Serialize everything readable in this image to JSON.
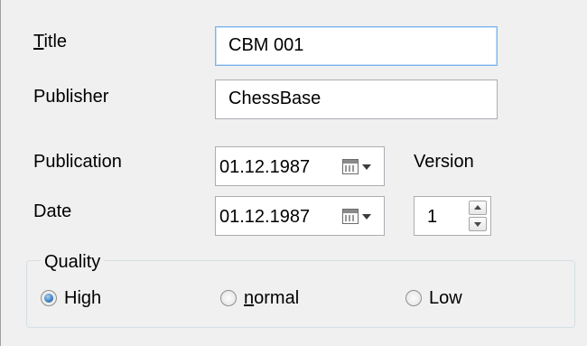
{
  "form": {
    "title": {
      "label_mnemonic": "T",
      "label_rest": "itle",
      "value": "CBM 001"
    },
    "publisher": {
      "label": "Publisher",
      "value": "ChessBase"
    },
    "publication": {
      "label": "Publication",
      "value": "01.12.1987"
    },
    "date": {
      "label": "Date",
      "value": "01.12.1987"
    },
    "version": {
      "label": "Version",
      "value": "1"
    }
  },
  "quality": {
    "title": "Quality",
    "options": [
      {
        "label": "High",
        "mnemonic": "",
        "checked": true
      },
      {
        "label_mnemonic": "n",
        "label_rest": "ormal",
        "checked": false
      },
      {
        "label": "Low",
        "checked": false
      }
    ]
  },
  "icons": {
    "calendar": "calendar-icon",
    "dropdown": "chevron-down-icon",
    "spin_up": "arrow-up-icon",
    "spin_down": "arrow-down-icon"
  },
  "colors": {
    "background": "#f0f0f0",
    "focus_border": "#7eb4ea",
    "radio_selected": "#2a6fb5"
  }
}
